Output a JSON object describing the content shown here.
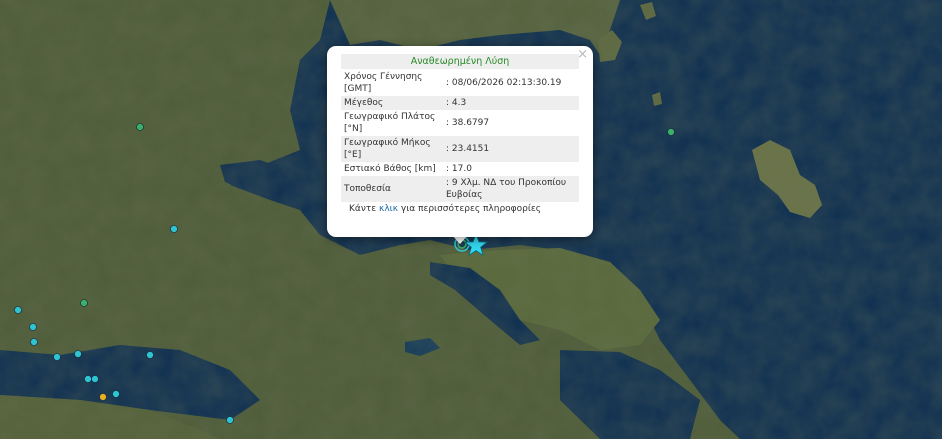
{
  "popup": {
    "title": "Αναθεωρημένη Λύση",
    "close_label": "×",
    "rows": [
      {
        "label": "Χρόνος Γέννησης [GMT]",
        "value": ": 08/06/2026 02:13:30.19"
      },
      {
        "label": "Μέγεθος",
        "value": ": 4.3"
      },
      {
        "label": "Γεωγραφικό Πλάτος [°N]",
        "value": ": 38.6797"
      },
      {
        "label": "Γεωγραφικό Μήκος [°E]",
        "value": ": 23.4151"
      },
      {
        "label": "Εστιακό Βάθος [km]",
        "value": ": 17.0"
      },
      {
        "label": "Τοποθεσία",
        "value": ": 9 Χλμ. ΝΔ του Προκοπίου Ευβοίας"
      }
    ],
    "more_before": "Κάντε",
    "more_link": "κλικ",
    "more_after": "για περισσότερες πληροφορίες"
  },
  "colors": {
    "sea": "#0e2f52",
    "land": "#4c5a3a",
    "marker_cyan": "#2fc4d2",
    "marker_green": "#3ab06a",
    "marker_yellow": "#e6b020",
    "star": "#33d6f0",
    "popup_title": "#2a8a2a",
    "link": "#1a6aa8"
  },
  "markers": {
    "epicenter_icon": "star-icon"
  }
}
